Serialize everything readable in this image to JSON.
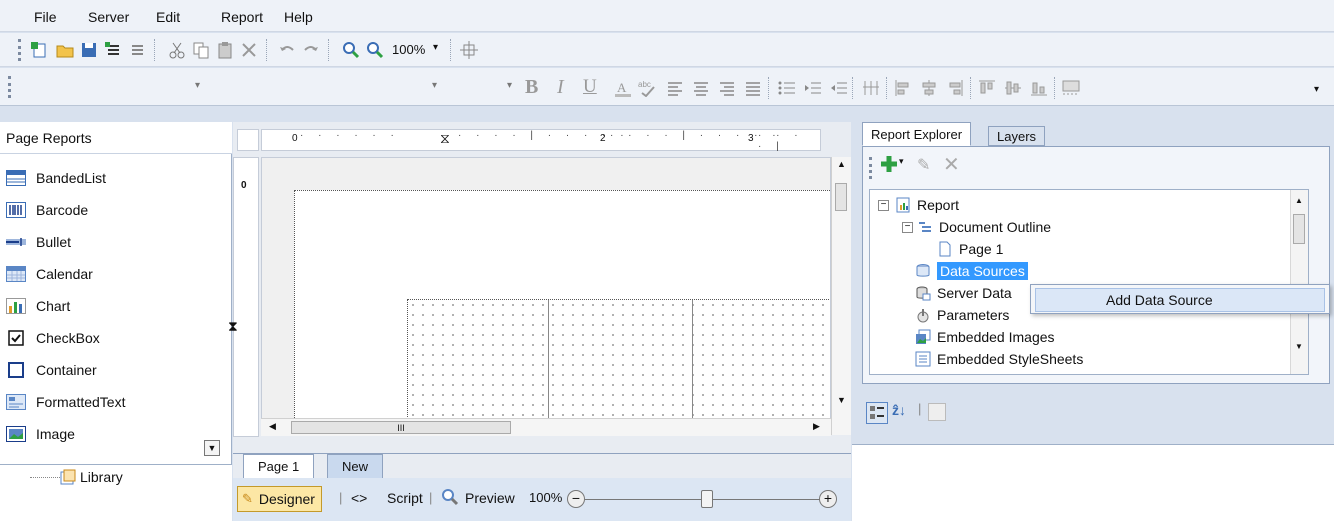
{
  "menu": [
    "File",
    "Server",
    "Edit",
    "Report",
    "Help"
  ],
  "toolbar": {
    "zoom_value": "100%"
  },
  "format_toolbar": {
    "bold": "B",
    "italic": "I",
    "underline": "U"
  },
  "left_panel": {
    "header": "Page Reports",
    "items": [
      {
        "label": "BandedList"
      },
      {
        "label": "Barcode"
      },
      {
        "label": "Bullet"
      },
      {
        "label": "Calendar"
      },
      {
        "label": "Chart"
      },
      {
        "label": "CheckBox"
      },
      {
        "label": "Container"
      },
      {
        "label": "FormattedText"
      },
      {
        "label": "Image"
      }
    ],
    "library_label": "Library"
  },
  "designer": {
    "ruler_top_marks": [
      "0",
      "1",
      "2",
      "3"
    ],
    "ruler_left_marks": [
      "0"
    ],
    "hscroll_label": "III",
    "tabs": [
      "Page 1",
      "New"
    ],
    "bottom": {
      "designer": "Designer",
      "script": "Script",
      "preview": "Preview",
      "zoom": "100%"
    }
  },
  "right_panel": {
    "tabs": [
      "Report Explorer",
      "Layers"
    ],
    "tree": [
      {
        "label": "Report"
      },
      {
        "label": "Document Outline"
      },
      {
        "label": "Page 1"
      },
      {
        "label": "Data Sources"
      },
      {
        "label": "Server Data"
      },
      {
        "label": "Parameters"
      },
      {
        "label": "Embedded Images"
      },
      {
        "label": "Embedded StyleSheets"
      }
    ],
    "context_menu": "Add Data Source"
  },
  "colors": {
    "selection": "#3399ff",
    "accent_green": "#2ea043"
  }
}
